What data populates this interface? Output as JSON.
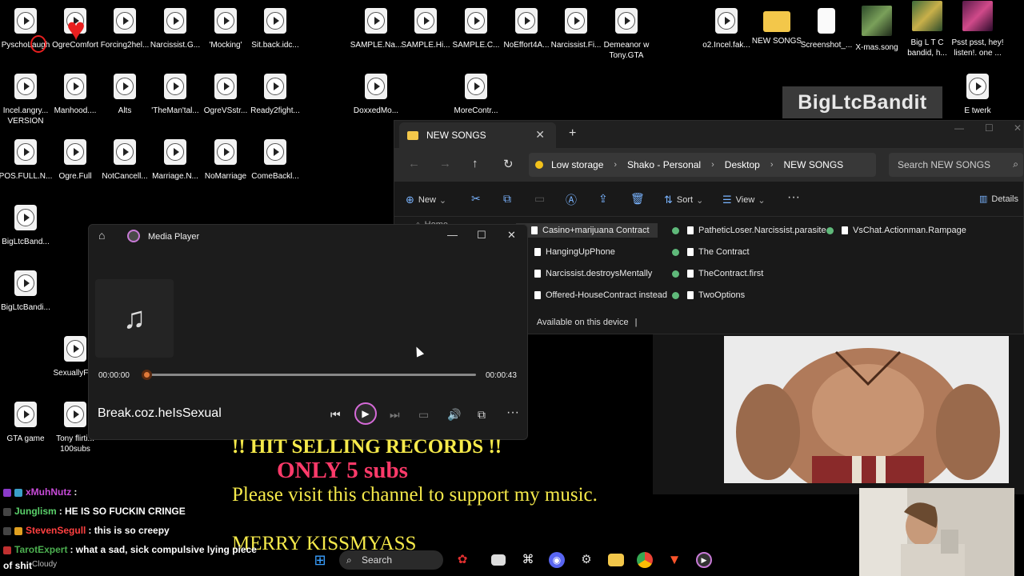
{
  "desktop": {
    "icons_row1": [
      "PyschoLaugh",
      "OgreComfort",
      "Forcing2hel...",
      "Narcissist.G...",
      "'Mocking'",
      "Sit.back.idc..."
    ],
    "icons_row1_mid": [
      "SAMPLE.Na...",
      "SAMPLE.Hi...",
      "SAMPLE.C...",
      "NoEffort4A...",
      "Narcissist.Fi...",
      "Demeanor w Tony.GTA"
    ],
    "icons_row1_right": [
      "o2.Incel.fak...",
      "NEW SONGS",
      "Screenshot_...",
      "X-mas.song",
      "Big L T C bandid, h...",
      "Psst psst, hey! listen!. one ..."
    ],
    "icons_row2": [
      "Incel.angry... VERSION",
      "Manhood....",
      "Alts",
      "'TheMan'tal...",
      "OgreVSstr...",
      "Ready2fight..."
    ],
    "icons_row2_mid": [
      "DoxxedMo...",
      "MoreContr..."
    ],
    "icons_row2_right": [
      "E twerk"
    ],
    "icons_row3": [
      "POS.FULL.N...",
      "Ogre.Full",
      "NotCancell...",
      "Marriage.N...",
      "NoMarriage",
      "ComeBackl..."
    ],
    "icons_col": [
      "BigLtcBand...",
      "BigLtcBandi...",
      "SexuallyFr...",
      "GTA game",
      "Tony flirti... 100subs"
    ],
    "watermark": "BigLtcBandit"
  },
  "explorer": {
    "tab_title": "NEW SONGS",
    "breadcrumb": [
      "Low storage",
      "Shako - Personal",
      "Desktop",
      "NEW SONGS"
    ],
    "search_placeholder": "Search NEW SONGS",
    "cmd_new": "New",
    "cmd_sort": "Sort",
    "cmd_view": "View",
    "cmd_details": "Details",
    "home_label": "Home",
    "files_col1": [
      "Casino+marijuana Contract",
      "HangingUpPhone",
      "Narcissist.destroysMentally",
      "Offered-HouseContract instead"
    ],
    "files_col2": [
      "PatheticLoser.Narcissist.parasite",
      "The Contract",
      "TheContract.first",
      "TwoOptions"
    ],
    "files_col3": [
      "VsChat.Actionman.Rampage"
    ],
    "status": "Available on this device"
  },
  "player": {
    "app_title": "Media Player",
    "elapsed": "00:00:00",
    "duration": "00:00:43",
    "progress": 0.0,
    "song_title": "Break.coz.heIsSexual"
  },
  "overlay": {
    "hit_text": "!! HIT SELLING RECORDS !!",
    "subs_text": "ONLY 5 subs",
    "visit_text": "Please visit this channel to support my music.",
    "merry_text": "MERRY KISSMYASS"
  },
  "chat": [
    {
      "user": "xMuhNutz",
      "text": ":",
      "color": "#c84bd9"
    },
    {
      "user": "Junglism",
      "text": ": HE IS SO FUCKIN CRINGE",
      "color": "#5ad06a"
    },
    {
      "user": "StevenSegull",
      "text": ": this is so creepy",
      "color": "#ff4040"
    },
    {
      "user": "TarotExpert",
      "text": ": what a sad, sick compulsive lying piece",
      "color": "#4caf50"
    },
    {
      "user": "",
      "text": "of shit",
      "color": "#ffffff"
    }
  ],
  "taskbar": {
    "search_label": "Search",
    "weather": "Cloudy"
  },
  "colors": {
    "accent_play": "#d56ad8",
    "overlay_yellow": "#f5e94a",
    "overlay_pink": "#ff3a6a",
    "folder_yellow": "#f3c74a"
  }
}
